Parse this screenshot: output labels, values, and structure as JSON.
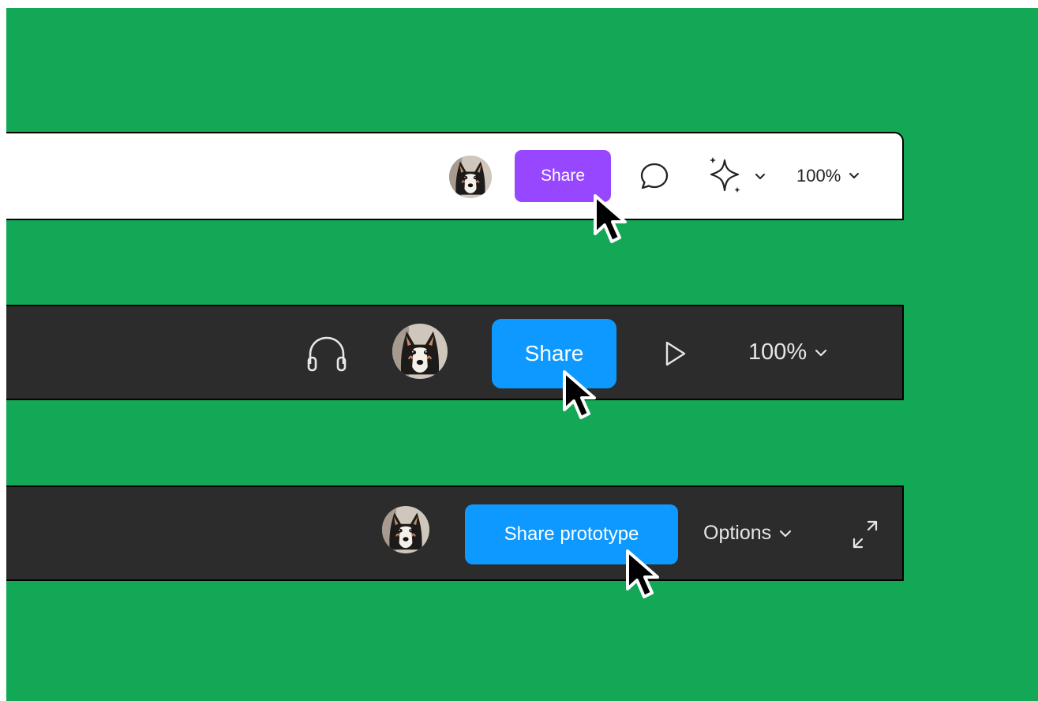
{
  "colors": {
    "canvas_bg": "#12a856",
    "light_bar": "#ffffff",
    "dark_bar": "#2c2c2c",
    "purple_accent": "#9747ff",
    "blue_accent": "#0d99ff"
  },
  "toolbar_light": {
    "share_label": "Share",
    "zoom_label": "100%",
    "icons": [
      "avatar",
      "comment-icon",
      "ai-sparkle-icon",
      "chevron-down-icon"
    ]
  },
  "toolbar_dark": {
    "share_label": "Share",
    "zoom_label": "100%",
    "icons": [
      "headphones-icon",
      "avatar",
      "play-icon",
      "chevron-down-icon"
    ]
  },
  "toolbar_prototype": {
    "share_label": "Share prototype",
    "options_label": "Options",
    "icons": [
      "avatar",
      "chevron-down-icon",
      "expand-icon"
    ]
  }
}
